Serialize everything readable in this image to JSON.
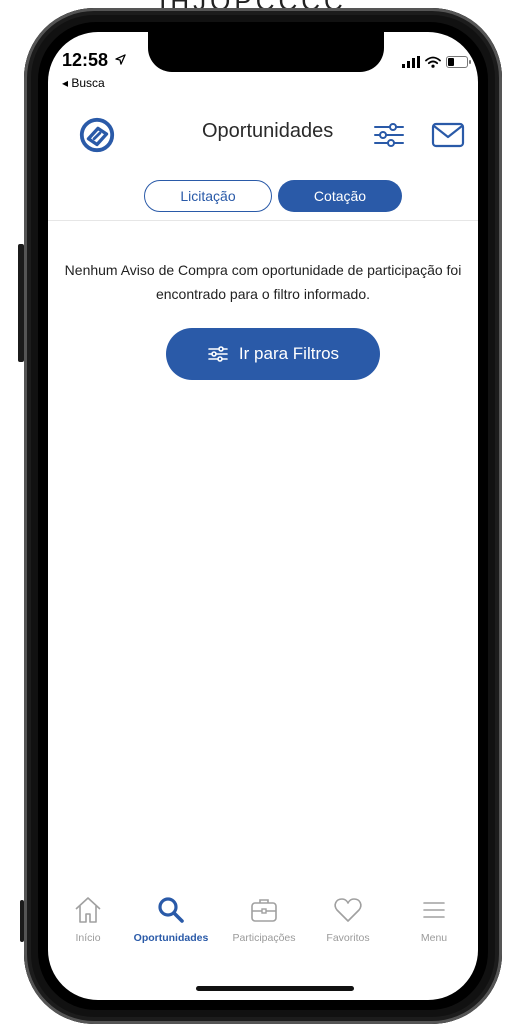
{
  "caption": "IHJOPCCCC",
  "status": {
    "time": "12:58",
    "back": "◂ Busca"
  },
  "header": {
    "title": "Oportunidades"
  },
  "tabs": [
    {
      "label": "Licitação",
      "selected": false
    },
    {
      "label": "Cotação",
      "selected": true
    }
  ],
  "empty": {
    "message": "Nenhum Aviso de Compra com oportunidade de participação foi encontrado para o filtro informado.",
    "button": "Ir para Filtros"
  },
  "nav": {
    "items": [
      {
        "label": "Início",
        "icon": "home-icon",
        "active": false
      },
      {
        "label": "Oportunidades",
        "icon": "search-icon",
        "active": true
      },
      {
        "label": "Participações",
        "icon": "briefcase-icon",
        "active": false
      },
      {
        "label": "Favoritos",
        "icon": "heart-icon",
        "active": false
      },
      {
        "label": "Menu",
        "icon": "menu-icon",
        "active": false
      }
    ]
  },
  "colors": {
    "accent": "#2a5aa8",
    "muted": "#9a9a9a",
    "text": "#222222"
  }
}
